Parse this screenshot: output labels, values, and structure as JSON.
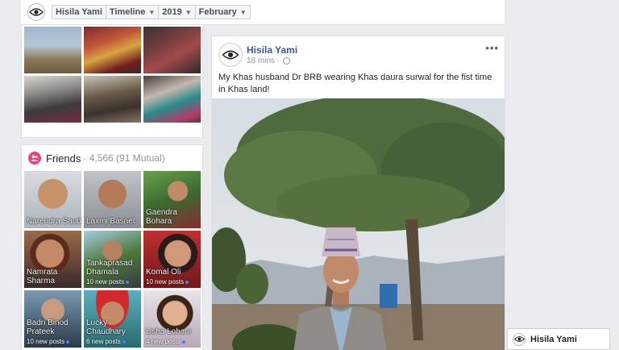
{
  "topbar": {
    "profile_name": "Hisila Yami",
    "section": "Timeline",
    "year": "2019",
    "month": "February",
    "caret": "▼"
  },
  "photos": {
    "items": [
      "photo-1",
      "photo-2",
      "photo-3",
      "photo-4",
      "photo-5",
      "photo-6"
    ]
  },
  "friends": {
    "title": "Friends",
    "count": "· 4,566 (91 Mutual)",
    "items": [
      {
        "name": "Narendra Saud",
        "posts": ""
      },
      {
        "name": "Laxmi Basnet",
        "posts": ""
      },
      {
        "name": "Gaendra Bohara",
        "posts": ""
      },
      {
        "name": "Namrata Sharma",
        "posts": ""
      },
      {
        "name": "Tankaprasad Dhamala",
        "posts": "10 new posts"
      },
      {
        "name": "Komal Oli",
        "posts": "10 new posts"
      },
      {
        "name": "Badri Binod Prateek",
        "posts": "10 new posts"
      },
      {
        "name": "Lucky Chaudhary",
        "posts": "6 new posts"
      },
      {
        "name": "Usha Lohani",
        "posts": "4 new posts"
      }
    ]
  },
  "post": {
    "author": "Hisila Yami",
    "time": "18 mins ·",
    "more": "•••",
    "text": "My Khas husband Dr BRB wearing Khas daura surwal for the fist time in Khas land!"
  },
  "chat": {
    "name": "Hisila Yami"
  },
  "colors": {
    "link": "#385898",
    "friends_icon": "#e8457c",
    "page_bg": "#e9ebee"
  }
}
